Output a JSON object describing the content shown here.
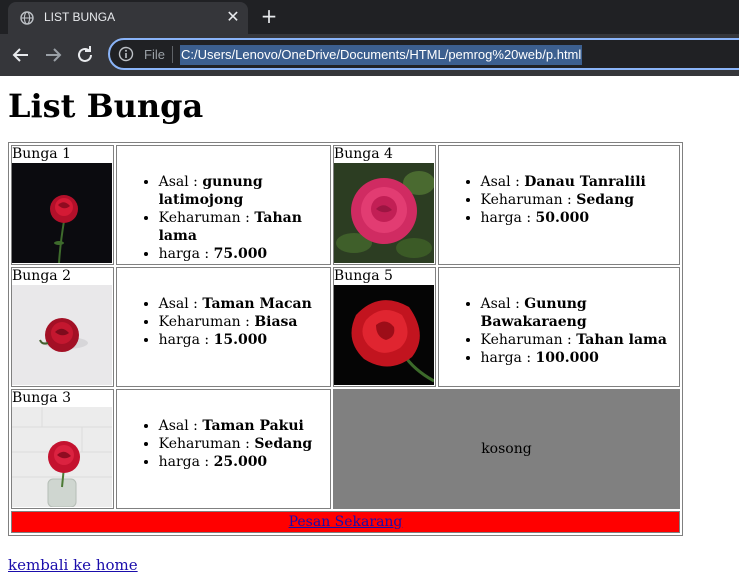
{
  "browser": {
    "tab_title": "LIST BUNGA",
    "close_glyph": "✕",
    "newtab_glyph": "+",
    "file_label": "File",
    "url": "C:/Users/Lenovo/OneDrive/Documents/HTML/pemrog%20web/p.html"
  },
  "page": {
    "title": "List Bunga",
    "flowers": [
      {
        "name": "Bunga 1",
        "asal": "gunung latimojong",
        "keharuman": "Tahan lama",
        "harga": "75.000"
      },
      {
        "name": "Bunga 2",
        "asal": "Taman Macan",
        "keharuman": "Biasa",
        "harga": "15.000"
      },
      {
        "name": "Bunga 3",
        "asal": "Taman Pakui",
        "keharuman": "Sedang",
        "harga": "25.000"
      },
      {
        "name": "Bunga 4",
        "asal": "Danau Tanralili",
        "keharuman": "Sedang",
        "harga": "50.000"
      },
      {
        "name": "Bunga 5",
        "asal": "Gunung Bawakaraeng",
        "keharuman": "Tahan lama",
        "harga": "100.000"
      }
    ],
    "labels": {
      "asal": "Asal : ",
      "keharuman": "Keharuman : ",
      "harga": "harga : "
    },
    "empty_cell": "kosong",
    "order_link": "Pesan Sekarang",
    "home_link": "kembali ke home"
  }
}
